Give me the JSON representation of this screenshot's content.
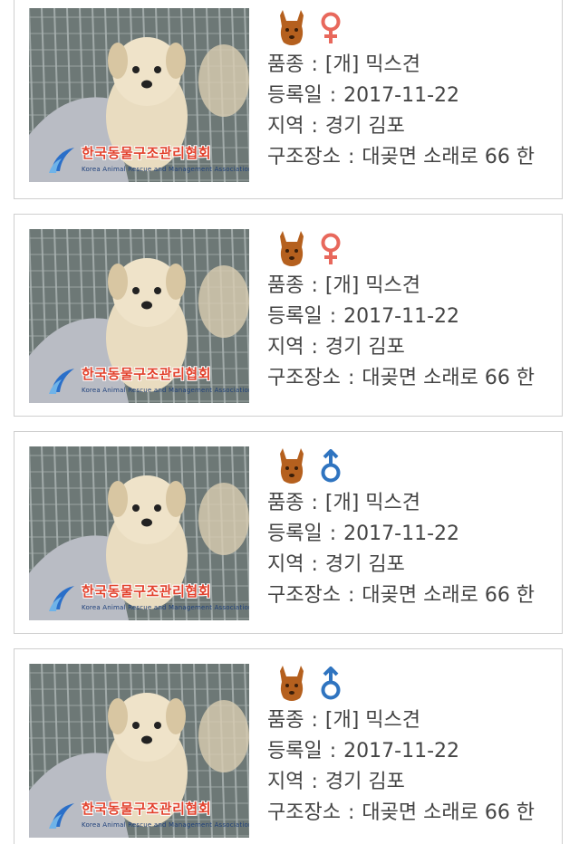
{
  "labels": {
    "breed": "품종",
    "registered": "등록일",
    "region": "지역",
    "rescue_place": "구조장소",
    "separator": ":"
  },
  "watermark": {
    "title": "한국동물구조관리협회",
    "subtitle": "Korea Animal Rescue and Management Association"
  },
  "colors": {
    "dog_icon": "#b5601e",
    "female": "#e8685c",
    "male": "#2f74c0",
    "border": "#cfcfcf",
    "text": "#444444"
  },
  "items": [
    {
      "species_icon": "dog-icon",
      "sex": "female",
      "sex_icon": "female-symbol-icon",
      "breed": "[개] 믹스견",
      "registered": "2017-11-22",
      "region": "경기 김포",
      "rescue_place": "대곶면 소래로 66 한"
    },
    {
      "species_icon": "dog-icon",
      "sex": "female",
      "sex_icon": "female-symbol-icon",
      "breed": "[개] 믹스견",
      "registered": "2017-11-22",
      "region": "경기 김포",
      "rescue_place": "대곶면 소래로 66 한"
    },
    {
      "species_icon": "dog-icon",
      "sex": "male",
      "sex_icon": "male-symbol-icon",
      "breed": "[개] 믹스견",
      "registered": "2017-11-22",
      "region": "경기 김포",
      "rescue_place": "대곶면 소래로 66 한"
    },
    {
      "species_icon": "dog-icon",
      "sex": "male",
      "sex_icon": "male-symbol-icon",
      "breed": "[개] 믹스견",
      "registered": "2017-11-22",
      "region": "경기 김포",
      "rescue_place": "대곶면 소래로 66 한"
    }
  ]
}
